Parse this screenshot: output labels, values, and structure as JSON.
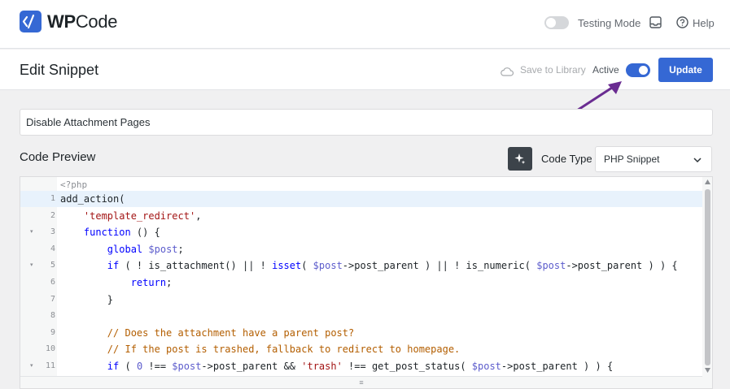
{
  "app": {
    "brand_bold": "WP",
    "brand_regular": "Code"
  },
  "topbar": {
    "testing_mode_label": "Testing Mode",
    "help_label": "Help"
  },
  "header": {
    "title": "Edit Snippet",
    "save_to_library_label": "Save to Library",
    "active_label": "Active",
    "active_on": true,
    "update_label": "Update"
  },
  "snippet": {
    "title_value": "Disable Attachment Pages"
  },
  "code_preview": {
    "section_title": "Code Preview",
    "code_type_label": "Code Type",
    "code_type_value": "PHP Snippet",
    "open_tag": "<?php",
    "highlighted_line": 1,
    "lines": [
      {
        "n": "1",
        "fold": false,
        "tokens": [
          [
            "f",
            "add_action("
          ]
        ]
      },
      {
        "n": "2",
        "fold": false,
        "tokens": [
          [
            "f",
            "    "
          ],
          [
            "s",
            "'template_redirect'"
          ],
          [
            "f",
            ","
          ]
        ]
      },
      {
        "n": "3",
        "fold": true,
        "tokens": [
          [
            "f",
            "    "
          ],
          [
            "k",
            "function"
          ],
          [
            "f",
            " () {"
          ]
        ]
      },
      {
        "n": "4",
        "fold": false,
        "tokens": [
          [
            "f",
            "        "
          ],
          [
            "k",
            "global"
          ],
          [
            "f",
            " "
          ],
          [
            "v",
            "$post"
          ],
          [
            "f",
            ";"
          ]
        ]
      },
      {
        "n": "5",
        "fold": true,
        "tokens": [
          [
            "f",
            "        "
          ],
          [
            "k",
            "if"
          ],
          [
            "f",
            " ( ! is_attachment() || ! "
          ],
          [
            "k",
            "isset"
          ],
          [
            "f",
            "( "
          ],
          [
            "v",
            "$post"
          ],
          [
            "f",
            "->post_parent ) || ! is_numeric( "
          ],
          [
            "v",
            "$post"
          ],
          [
            "f",
            "->post_parent ) ) {"
          ]
        ]
      },
      {
        "n": "6",
        "fold": false,
        "tokens": [
          [
            "f",
            "            "
          ],
          [
            "k",
            "return"
          ],
          [
            "f",
            ";"
          ]
        ]
      },
      {
        "n": "7",
        "fold": false,
        "tokens": [
          [
            "f",
            "        }"
          ]
        ]
      },
      {
        "n": "8",
        "fold": false,
        "tokens": [
          [
            "f",
            ""
          ]
        ]
      },
      {
        "n": "9",
        "fold": false,
        "tokens": [
          [
            "f",
            "        "
          ],
          [
            "c",
            "// Does the attachment have a parent post?"
          ]
        ]
      },
      {
        "n": "10",
        "fold": false,
        "tokens": [
          [
            "f",
            "        "
          ],
          [
            "c",
            "// If the post is trashed, fallback to redirect to homepage."
          ]
        ]
      },
      {
        "n": "11",
        "fold": true,
        "tokens": [
          [
            "f",
            "        "
          ],
          [
            "k",
            "if"
          ],
          [
            "f",
            " ( "
          ],
          [
            "v",
            "0"
          ],
          [
            "f",
            " !== "
          ],
          [
            "v",
            "$post"
          ],
          [
            "f",
            "->post_parent && "
          ],
          [
            "s",
            "'trash'"
          ],
          [
            "f",
            " !== get_post_status( "
          ],
          [
            "v",
            "$post"
          ],
          [
            "f",
            "->post_parent ) ) {"
          ]
        ]
      }
    ]
  },
  "colors": {
    "accent": "#3568d4",
    "annotation_arrow": "#6a2c91"
  }
}
